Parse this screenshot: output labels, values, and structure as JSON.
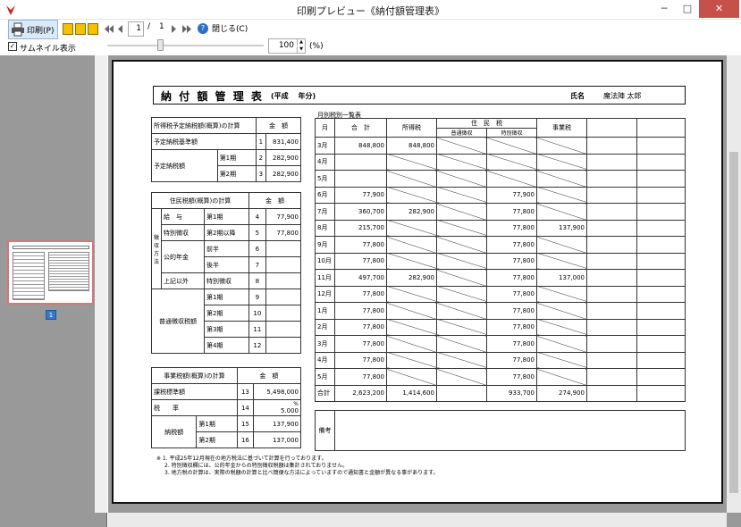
{
  "window": {
    "title": "印刷プレビュー《納付額管理表》",
    "minimize": "─",
    "maximize": "□",
    "close": "✕"
  },
  "toolbar": {
    "print_label": "印刷(P)",
    "page_current": "1",
    "page_sep": "/",
    "page_total": "1",
    "close_label": "閉じる(C)",
    "help": "?"
  },
  "toolbar2": {
    "thumbnail_label": "サムネイル表示",
    "thumbnail_checked": "✓",
    "zoom_value": "100",
    "zoom_unit": "(%)"
  },
  "thumbnail": {
    "page_badge": "1"
  },
  "doc": {
    "title": "納 付 額 管 理 表",
    "era": "(平成　 年分)",
    "name_label": "氏名",
    "name_value": "魔法陣 太郎",
    "monthly_heading": "月別税別一覧表",
    "t1": {
      "h1": "所得税予定納税額(概算)の計算",
      "h2": "金　額",
      "rows": [
        {
          "label": "予定納税基準額",
          "no": "1",
          "amount": "831,400"
        },
        {
          "label": "予定納税額",
          "sub": "第1期",
          "no": "2",
          "amount": "282,900"
        },
        {
          "label": "",
          "sub": "第2期",
          "no": "3",
          "amount": "282,900"
        }
      ]
    },
    "t2": {
      "h1": "住民税額(概算)の計算",
      "h2": "金　額",
      "side": "徴収方法",
      "rows": [
        {
          "a": "給　与",
          "b": "第1期",
          "no": "4",
          "amount": "77,900"
        },
        {
          "a": "特別徴収",
          "b": "第2期以降",
          "no": "5",
          "amount": "77,800"
        },
        {
          "a": "公的年金",
          "b": "前半",
          "no": "6",
          "amount": ""
        },
        {
          "a": "",
          "b": "後半",
          "no": "7",
          "amount": ""
        },
        {
          "a": "上記以外",
          "b": "特別徴収",
          "no": "8",
          "amount": ""
        },
        {
          "a": "普通徴収税額",
          "b": "第1期",
          "no": "9",
          "amount": ""
        },
        {
          "a": "",
          "b": "第2期",
          "no": "10",
          "amount": ""
        },
        {
          "a": "",
          "b": "第3期",
          "no": "11",
          "amount": ""
        },
        {
          "a": "",
          "b": "第4期",
          "no": "12",
          "amount": ""
        }
      ]
    },
    "t3": {
      "h1": "事業税額(概算)の計算",
      "h2": "金　額",
      "rows": [
        {
          "label": "課税標準額",
          "no": "13",
          "amount": "5,498,000"
        },
        {
          "label": "税　　率",
          "no": "14",
          "amount": "5.000",
          "unit": "%"
        },
        {
          "label": "納税額",
          "sub": "第1期",
          "no": "15",
          "amount": "137,900"
        },
        {
          "label": "",
          "sub": "第2期",
          "no": "16",
          "amount": "137,000"
        }
      ]
    },
    "monthly": {
      "headers": [
        "月",
        "合　計",
        "所得税",
        "住　民　税",
        "事業税"
      ],
      "sub_headers": [
        "普通徴収",
        "特別徴収"
      ],
      "rows": [
        {
          "m": "3月",
          "total": "848,800",
          "income": "848,800",
          "ordinary": "",
          "special": "",
          "biz": ""
        },
        {
          "m": "4月",
          "total": "",
          "income": "",
          "ordinary": "",
          "special": "",
          "biz": ""
        },
        {
          "m": "5月",
          "total": "",
          "income": "",
          "ordinary": "",
          "special": "",
          "biz": ""
        },
        {
          "m": "6月",
          "total": "77,900",
          "income": "",
          "ordinary": "",
          "special": "77,900",
          "biz": ""
        },
        {
          "m": "7月",
          "total": "360,700",
          "income": "282,900",
          "ordinary": "",
          "special": "77,800",
          "biz": ""
        },
        {
          "m": "8月",
          "total": "215,700",
          "income": "",
          "ordinary": "",
          "special": "77,800",
          "biz": "137,900"
        },
        {
          "m": "9月",
          "total": "77,800",
          "income": "",
          "ordinary": "",
          "special": "77,800",
          "biz": ""
        },
        {
          "m": "10月",
          "total": "77,800",
          "income": "",
          "ordinary": "",
          "special": "77,800",
          "biz": ""
        },
        {
          "m": "11月",
          "total": "497,700",
          "income": "282,900",
          "ordinary": "",
          "special": "77,800",
          "biz": "137,000"
        },
        {
          "m": "12月",
          "total": "77,800",
          "income": "",
          "ordinary": "",
          "special": "77,800",
          "biz": ""
        },
        {
          "m": "1月",
          "total": "77,800",
          "income": "",
          "ordinary": "",
          "special": "77,800",
          "biz": ""
        },
        {
          "m": "2月",
          "total": "77,800",
          "income": "",
          "ordinary": "",
          "special": "77,800",
          "biz": ""
        },
        {
          "m": "3月",
          "total": "77,800",
          "income": "",
          "ordinary": "",
          "special": "77,800",
          "biz": ""
        },
        {
          "m": "4月",
          "total": "77,800",
          "income": "",
          "ordinary": "",
          "special": "77,800",
          "biz": ""
        },
        {
          "m": "5月",
          "total": "77,800",
          "income": "",
          "ordinary": "",
          "special": "77,800",
          "biz": ""
        },
        {
          "m": "合計",
          "total": "2,623,200",
          "income": "1,414,600",
          "ordinary": "",
          "special": "933,700",
          "biz": "274,900"
        }
      ]
    },
    "remarks_label": "備考",
    "notes": [
      "※ 1. 平成25年12月現在の地方税法に基づいて計算を行っております。",
      "2. 特別徴収欄には、公的年金からの特別徴収税額は集計されておりません。",
      "3. 地方税の計算は、実際の税額の計算と比べ簡便な方法によっていますので通知書と金額が異なる事があります。"
    ]
  }
}
